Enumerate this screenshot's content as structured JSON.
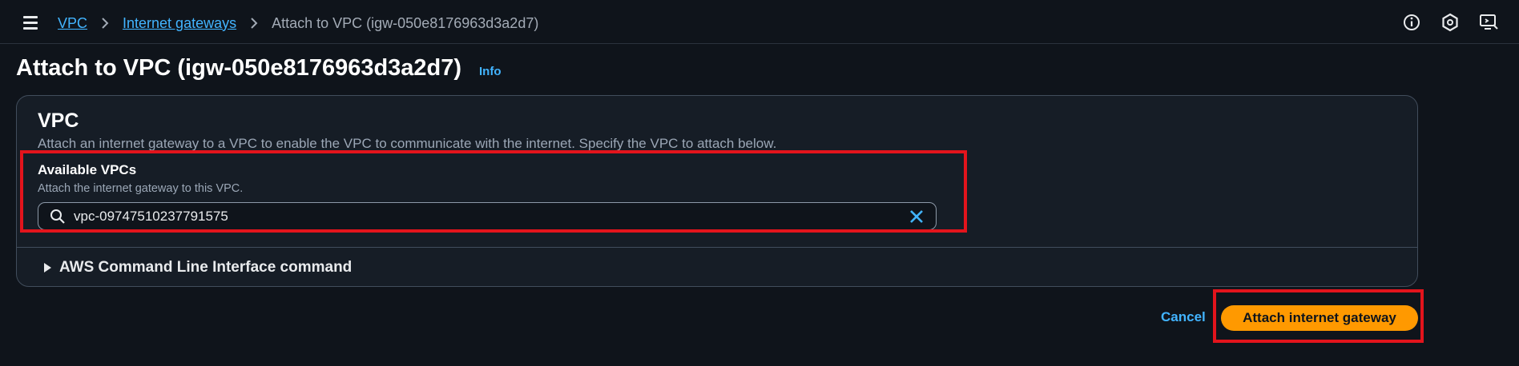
{
  "breadcrumb": {
    "items": [
      {
        "label": "VPC"
      },
      {
        "label": "Internet gateways"
      }
    ],
    "current": "Attach to VPC (igw-050e8176963d3a2d7)"
  },
  "header": {
    "icons": [
      "info-circle-icon",
      "settings-hex-icon",
      "feedback-screen-icon"
    ]
  },
  "page": {
    "title": "Attach to VPC (igw-050e8176963d3a2d7)",
    "info_label": "Info"
  },
  "panel": {
    "title": "VPC",
    "description": "Attach an internet gateway to a VPC to enable the VPC to communicate with the internet. Specify the VPC to attach below.",
    "field": {
      "label": "Available VPCs",
      "description": "Attach the internet gateway to this VPC.",
      "value": "vpc-09747510237791575"
    },
    "expander_label": "AWS Command Line Interface command"
  },
  "actions": {
    "cancel_label": "Cancel",
    "primary_label": "Attach internet gateway"
  },
  "colors": {
    "background": "#0f141b",
    "panel": "#161d26",
    "link": "#42b4ff",
    "primary": "#ff9900",
    "highlight": "#e3141c"
  }
}
